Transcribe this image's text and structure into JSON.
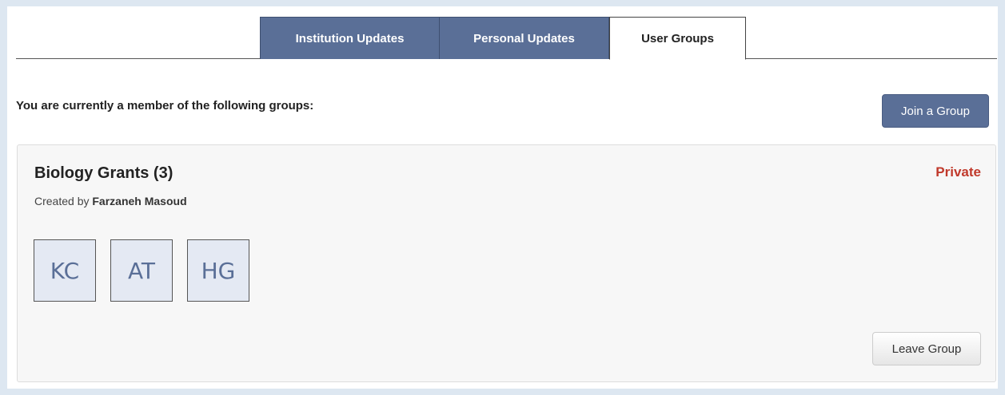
{
  "tabs": [
    {
      "label": "Institution Updates",
      "active": false
    },
    {
      "label": "Personal Updates",
      "active": false
    },
    {
      "label": "User Groups",
      "active": true
    }
  ],
  "intro_text": "You are currently a member of the following groups:",
  "join_button_label": "Join a Group",
  "group": {
    "title": "Biology Grants (3)",
    "privacy": "Private",
    "created_by_prefix": "Created by",
    "creator_name": "Farzaneh Masoud",
    "members": [
      "KC",
      "AT",
      "HG"
    ],
    "leave_button_label": "Leave Group"
  },
  "colors": {
    "accent": "#5a6f97",
    "private": "#c0392b",
    "page_background": "#dde7f1",
    "card_background": "#f7f7f7"
  }
}
